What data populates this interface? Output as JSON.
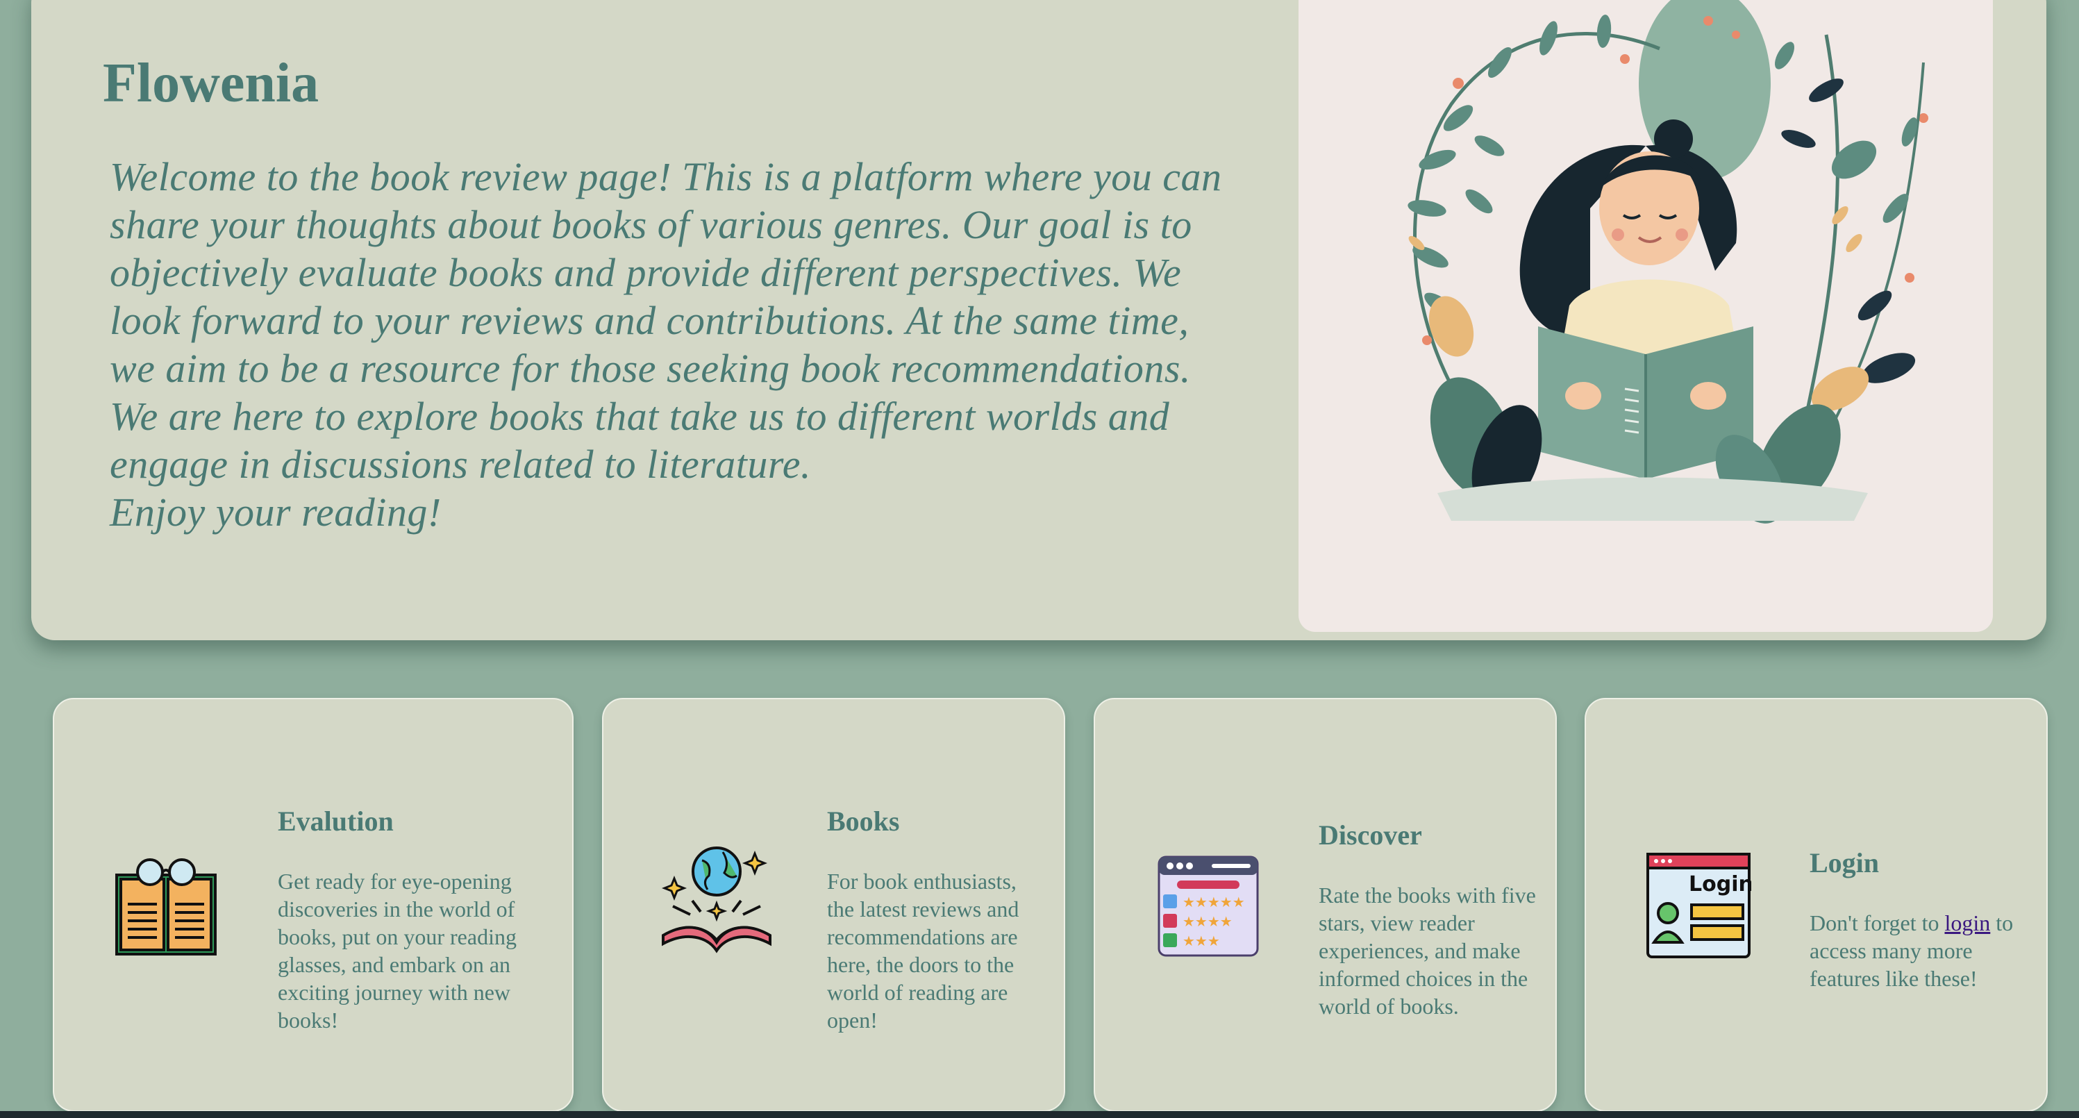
{
  "hero": {
    "title": "Flowenia",
    "lines": [
      "Welcome to the book review page! This is a platform where you can",
      "share your thoughts about books of various genres. Our goal is to",
      "objectively evaluate books and provide different perspectives. We",
      "look forward to your reviews and contributions. At the same time,",
      "we aim to be a resource for those seeking book recommendations.",
      "We are here to explore books that take us to different worlds and",
      "engage in discussions related to literature.",
      "Enjoy your reading!"
    ]
  },
  "cards": [
    {
      "title": "Evalution",
      "icon": "open-book-glasses-icon",
      "text_lines": [
        "Get ready for eye-opening",
        "discoveries in the world of",
        "books, put on your reading",
        "glasses, and embark on an",
        "exciting journey with new",
        "books!"
      ]
    },
    {
      "title": "Books",
      "icon": "globe-book-icon",
      "text_lines": [
        "For book enthusiasts,",
        "the latest reviews and",
        "recommendations are",
        "here, the doors to the",
        "world of reading are",
        "open!"
      ]
    },
    {
      "title": "Discover",
      "icon": "rating-list-icon",
      "text_lines": [
        "Rate the books with five",
        "stars, view reader",
        "experiences, and make",
        "informed choices in the",
        "world of books."
      ]
    },
    {
      "title": "Login",
      "icon": "login-window-icon",
      "text_before": "Don't forget to",
      "link_label": "login",
      "text_after": "to",
      "text_lines": [
        "access many more",
        "features like these!"
      ],
      "icon_label": "Login"
    }
  ],
  "colors": {
    "background": "#8fae9d",
    "panel": "#d4d8c7",
    "text": "#4a7a74",
    "link": "#3a1880"
  }
}
